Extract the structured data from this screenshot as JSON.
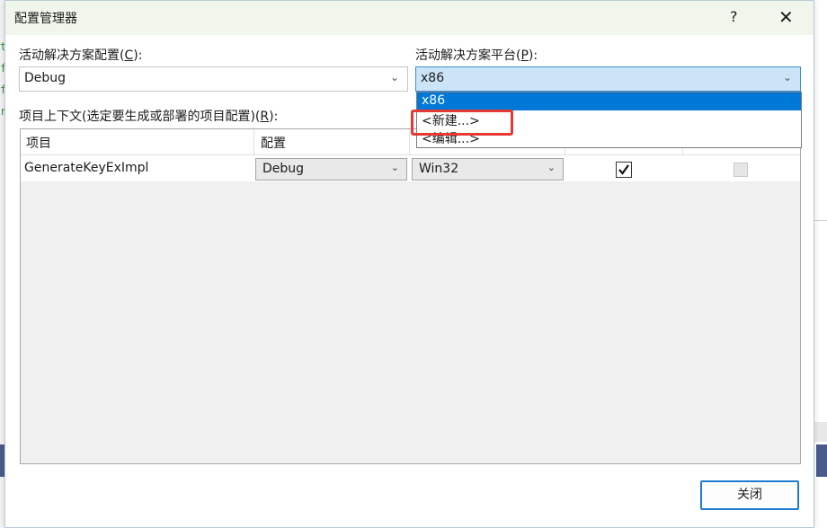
{
  "dialog": {
    "title": "配置管理器",
    "help_glyph": "?",
    "close_glyph": "✕"
  },
  "active_config": {
    "label_prefix": "活动解决方案配置(",
    "label_key": "C",
    "label_suffix": "):",
    "value": "Debug"
  },
  "active_platform": {
    "label_prefix": "活动解决方案平台(",
    "label_key": "P",
    "label_suffix": "):",
    "value": "x86",
    "options": [
      "x86",
      "<新建...>",
      "<编辑...>"
    ],
    "selected_index": 0,
    "highlighted_option": "<新建...>"
  },
  "project_context": {
    "label_prefix": "项目上下文(选定要生成或部署的项目配置)(",
    "label_key": "R",
    "label_suffix": "):",
    "columns": [
      "项目",
      "配置"
    ],
    "rows": [
      {
        "project": "GenerateKeyExImpl",
        "config": "Debug",
        "platform": "Win32",
        "build": true,
        "deploy": false
      }
    ]
  },
  "buttons": {
    "close": "关闭"
  },
  "icons": {
    "dropdown_arrow": "chevron-down-icon",
    "check": "check-icon"
  }
}
